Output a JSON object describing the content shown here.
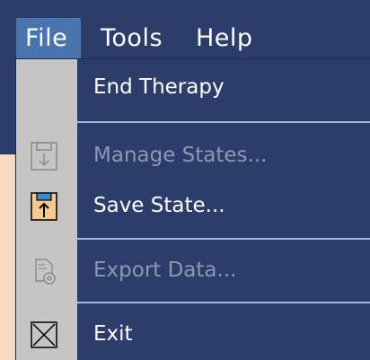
{
  "menubar": {
    "items": [
      {
        "label": "File",
        "active": true
      },
      {
        "label": "Tools",
        "active": false
      },
      {
        "label": "Help",
        "active": false
      }
    ]
  },
  "file_menu": {
    "items": [
      {
        "label": "End Therapy",
        "enabled": true,
        "icon": "none"
      },
      {
        "label": "Manage States...",
        "enabled": false,
        "icon": "floppy-download-icon"
      },
      {
        "label": "Save State...",
        "enabled": true,
        "icon": "floppy-upload-icon"
      },
      {
        "label": "Export Data...",
        "enabled": false,
        "icon": "export-gear-icon"
      },
      {
        "label": "Exit",
        "enabled": true,
        "icon": "close-box-icon"
      }
    ]
  },
  "colors": {
    "menubar_bg": "#2c3d6b",
    "active_item_bg": "#4a74ad",
    "gutter_bg": "#c5c5c5",
    "separator": "#a9b6d4",
    "enabled_text": "#ffffff",
    "disabled_text": "#8c97b3",
    "save_icon_fill": "#f7c98f"
  }
}
